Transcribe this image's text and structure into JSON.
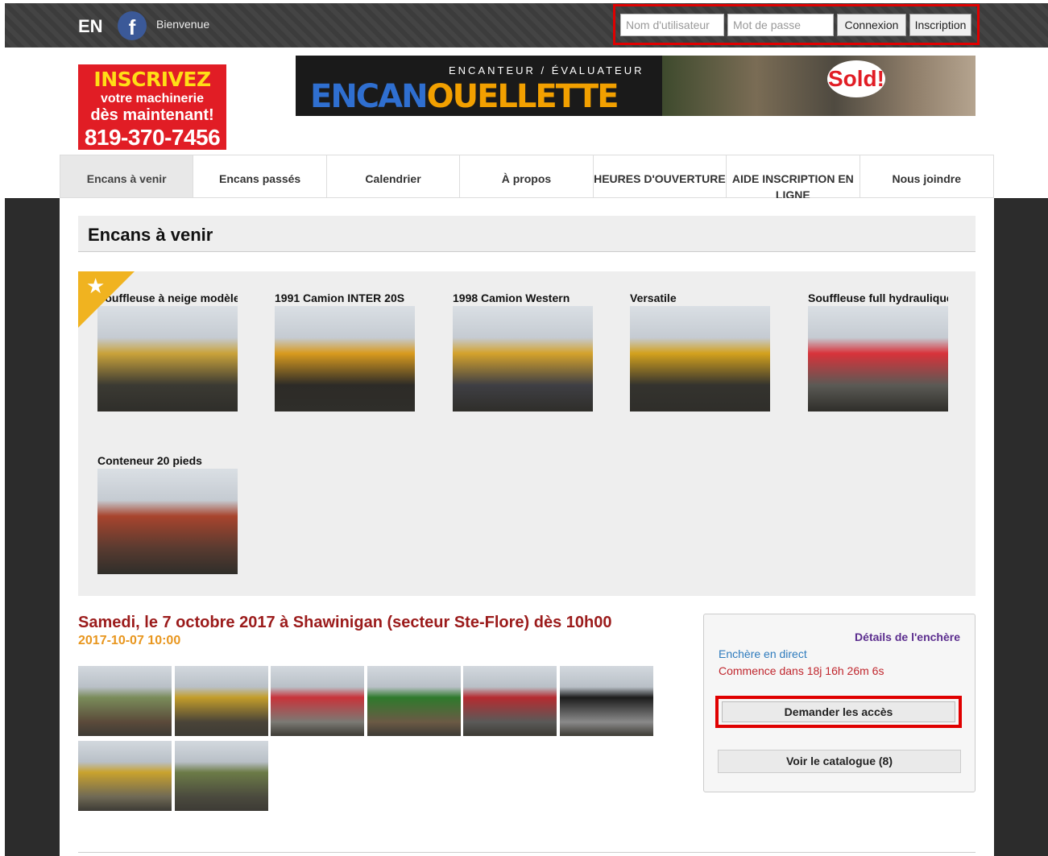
{
  "topbar": {
    "lang": "EN",
    "facebook_glyph": "f",
    "welcome": "Bienvenue",
    "username_placeholder": "Nom d'utilisateur",
    "password_placeholder": "Mot de passe",
    "login_label": "Connexion",
    "register_label": "Inscription"
  },
  "promo": {
    "line1": "INSCRIVEZ",
    "line2": "votre machinerie",
    "line3": "dès maintenant!",
    "phone": "819-370-7456"
  },
  "banner": {
    "tagline": "ENCANTEUR / ÉVALUATEUR",
    "brand_part1": "ENCAN",
    "brand_part2": "OUELLETTE",
    "sold": "Sold!"
  },
  "nav": {
    "items": [
      {
        "label": "Encans à venir",
        "active": true
      },
      {
        "label": "Encans passés"
      },
      {
        "label": "Calendrier"
      },
      {
        "label": "À propos"
      },
      {
        "label": "HEURES D'OUVERTURE"
      },
      {
        "label": "AIDE INSCRIPTION EN LIGNE"
      },
      {
        "label": "Nous joindre"
      }
    ]
  },
  "page_title": "Encans à venir",
  "featured": {
    "star_icon": "star-icon",
    "items": [
      {
        "caption": "Souffleuse à neige modèle",
        "color_a": "#c9a23a",
        "color_b": "#3b3a33"
      },
      {
        "caption": "1991 Camion INTER 20S",
        "color_a": "#d89a1e",
        "color_b": "#2d2b27"
      },
      {
        "caption": "1998 Camion Western",
        "color_a": "#d4a22c",
        "color_b": "#3f3f44"
      },
      {
        "caption": "Versatile",
        "color_a": "#d3a11d",
        "color_b": "#34332e"
      },
      {
        "caption": "Souffleuse full hydraulique",
        "color_a": "#d8323a",
        "color_b": "#5b5a55"
      },
      {
        "caption": "Conteneur 20 pieds",
        "color_a": "#a8442d",
        "color_b": "#5a3b30"
      }
    ]
  },
  "auction": {
    "title": "Samedi, le 7 octobre 2017 à Shawinigan (secteur Ste-Flore) dès 10h00",
    "date": "2017-10-07 10:00",
    "details_link": "Détails de l'enchère",
    "live_label": "Enchère en direct",
    "countdown": "Commence dans 18j 16h 26m 6s",
    "request_access_label": "Demander les accès",
    "catalog_label": "Voir le catalogue (8)",
    "thumbs": [
      {
        "a": "#7a8c5a",
        "b": "#5b4a3a"
      },
      {
        "a": "#c39d2a",
        "b": "#4a4438"
      },
      {
        "a": "#c8333a",
        "b": "#7b7a74"
      },
      {
        "a": "#2e7a2c",
        "b": "#6b5a45"
      },
      {
        "a": "#b52b30",
        "b": "#5a5a58"
      },
      {
        "a": "#1c1c1c",
        "b": "#8a8a8a"
      },
      {
        "a": "#c9a22d",
        "b": "#6f6955"
      },
      {
        "a": "#6c7b47",
        "b": "#4b4a3e"
      }
    ]
  }
}
